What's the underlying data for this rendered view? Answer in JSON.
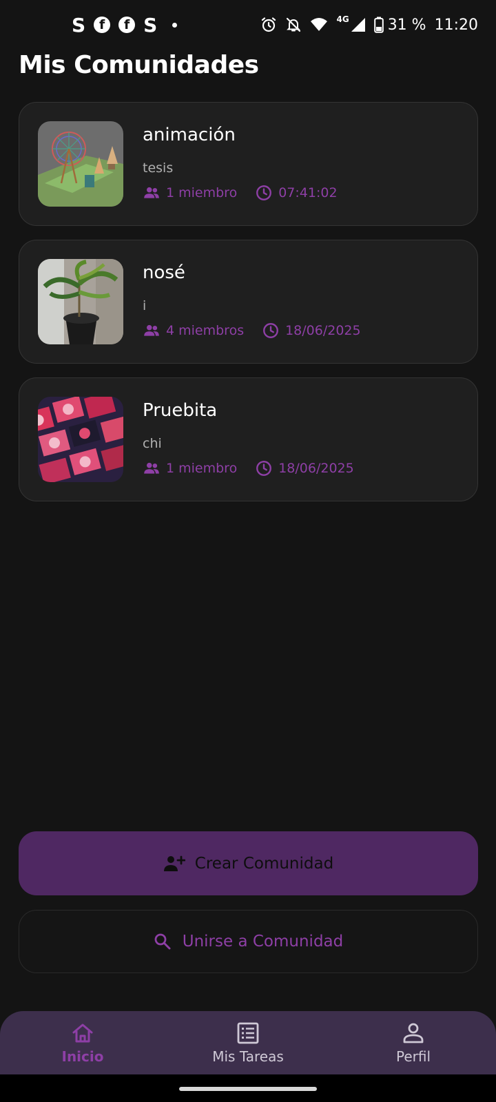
{
  "status_bar": {
    "left_icons": [
      "S",
      "f",
      "f",
      "S"
    ],
    "battery": "31 %",
    "network": "4G",
    "time": "11:20"
  },
  "page": {
    "title": "Mis Comunidades"
  },
  "communities": [
    {
      "name": "animación",
      "description": "tesis",
      "members": "1 miembro",
      "time": "07:41:02",
      "thumbnail": "3d-ferris-wheel-scene"
    },
    {
      "name": "nosé",
      "description": "i",
      "members": "4 miembros",
      "time": "18/06/2025",
      "thumbnail": "potted-plant-photo"
    },
    {
      "name": "Pruebita",
      "description": "chi",
      "members": "1 miembro",
      "time": "18/06/2025",
      "thumbnail": "pink-stickers-pattern"
    }
  ],
  "actions": {
    "create_label": "Crear Comunidad",
    "join_label": "Unirse a Comunidad"
  },
  "bottom_nav": [
    {
      "label": "Inicio",
      "icon": "home-icon",
      "active": true
    },
    {
      "label": "Mis Tareas",
      "icon": "task-list-icon",
      "active": false
    },
    {
      "label": "Perfil",
      "icon": "person-icon",
      "active": false
    }
  ],
  "colors": {
    "background": "#141414",
    "card": "#1f1f1f",
    "accent": "#8e3fa6",
    "primary_button": "#4f2862",
    "nav_bar": "#3d2f4c"
  }
}
